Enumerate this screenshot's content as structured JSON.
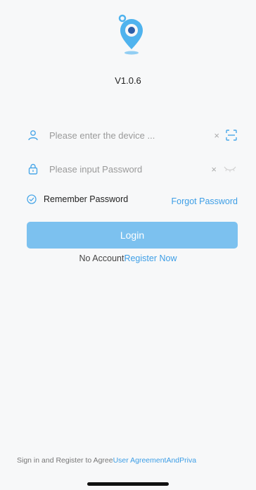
{
  "app": {
    "version": "V1.0.6"
  },
  "form": {
    "device_placeholder": "Please enter the device ...",
    "clear_symbol": "×",
    "password_placeholder": "Please input Password",
    "remember_label": "Remember Password",
    "forgot_label": "Forgot Password",
    "login_label": "Login"
  },
  "register": {
    "prefix": "No Account",
    "link": "Register Now"
  },
  "agreement": {
    "prefix": "Sign in and Register to Agree",
    "user_agreement": "User Agreement",
    "and": "And",
    "privacy": "Priva"
  },
  "colors": {
    "accent": "#3d9ee6",
    "button": "#7cc1ef",
    "background": "#f7f8f9"
  }
}
